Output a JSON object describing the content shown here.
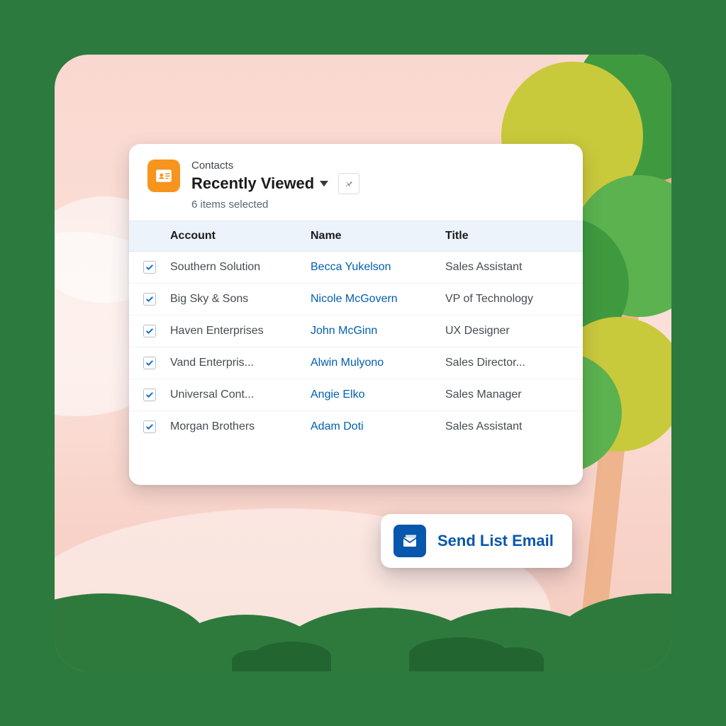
{
  "header": {
    "object_label": "Contacts",
    "view_name": "Recently Viewed",
    "selected_text": "6 items selected"
  },
  "table": {
    "columns": {
      "account": "Account",
      "name": "Name",
      "title": "Title"
    },
    "rows": [
      {
        "checked": true,
        "account": "Southern Solution",
        "name": "Becca Yukelson",
        "title": "Sales Assistant"
      },
      {
        "checked": true,
        "account": "Big Sky & Sons",
        "name": "Nicole McGovern",
        "title": "VP of Technology"
      },
      {
        "checked": true,
        "account": "Haven Enterprises",
        "name": "John McGinn",
        "title": "UX Designer"
      },
      {
        "checked": true,
        "account": "Vand Enterpris...",
        "name": "Alwin Mulyono",
        "title": "Sales Director..."
      },
      {
        "checked": true,
        "account": "Universal Cont...",
        "name": "Angie Elko",
        "title": "Sales Manager"
      },
      {
        "checked": true,
        "account": "Morgan Brothers",
        "name": "Adam Doti",
        "title": "Sales Assistant"
      }
    ]
  },
  "action": {
    "send_list_email_label": "Send List Email"
  },
  "colors": {
    "link": "#005fb2",
    "brand_orange": "#f7941d",
    "brand_blue": "#0757ad"
  }
}
